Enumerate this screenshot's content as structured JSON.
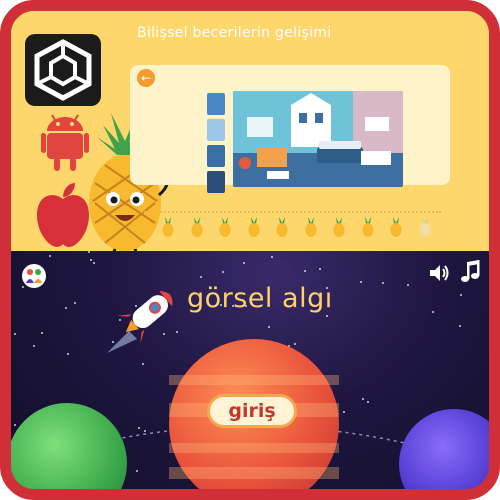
{
  "top_app": {
    "title": "Bilişsel becerilerin gelişimi",
    "back_icon": "arrow-left-icon"
  },
  "platform_badges": {
    "brand_icon": "unity-cube-icon",
    "android_icon": "android-robot-icon",
    "apple_icon": "apple-logo-icon",
    "mascot": "pineapple-mascot"
  },
  "progress": {
    "total_steps": 10,
    "completed_steps": 9
  },
  "game": {
    "title": "görsel algı",
    "start_label": "giriş",
    "sound_icon": "speaker-icon",
    "music_icon": "music-note-icon",
    "logo_icon": "family-logo-icon",
    "rocket_icon": "rocket-icon"
  },
  "colors": {
    "frame": "#d02f38",
    "top_bg": "#fdd66c",
    "space_bg": "#1e1640",
    "title_gold": "#ffd36b",
    "start_text": "#c0392b"
  }
}
